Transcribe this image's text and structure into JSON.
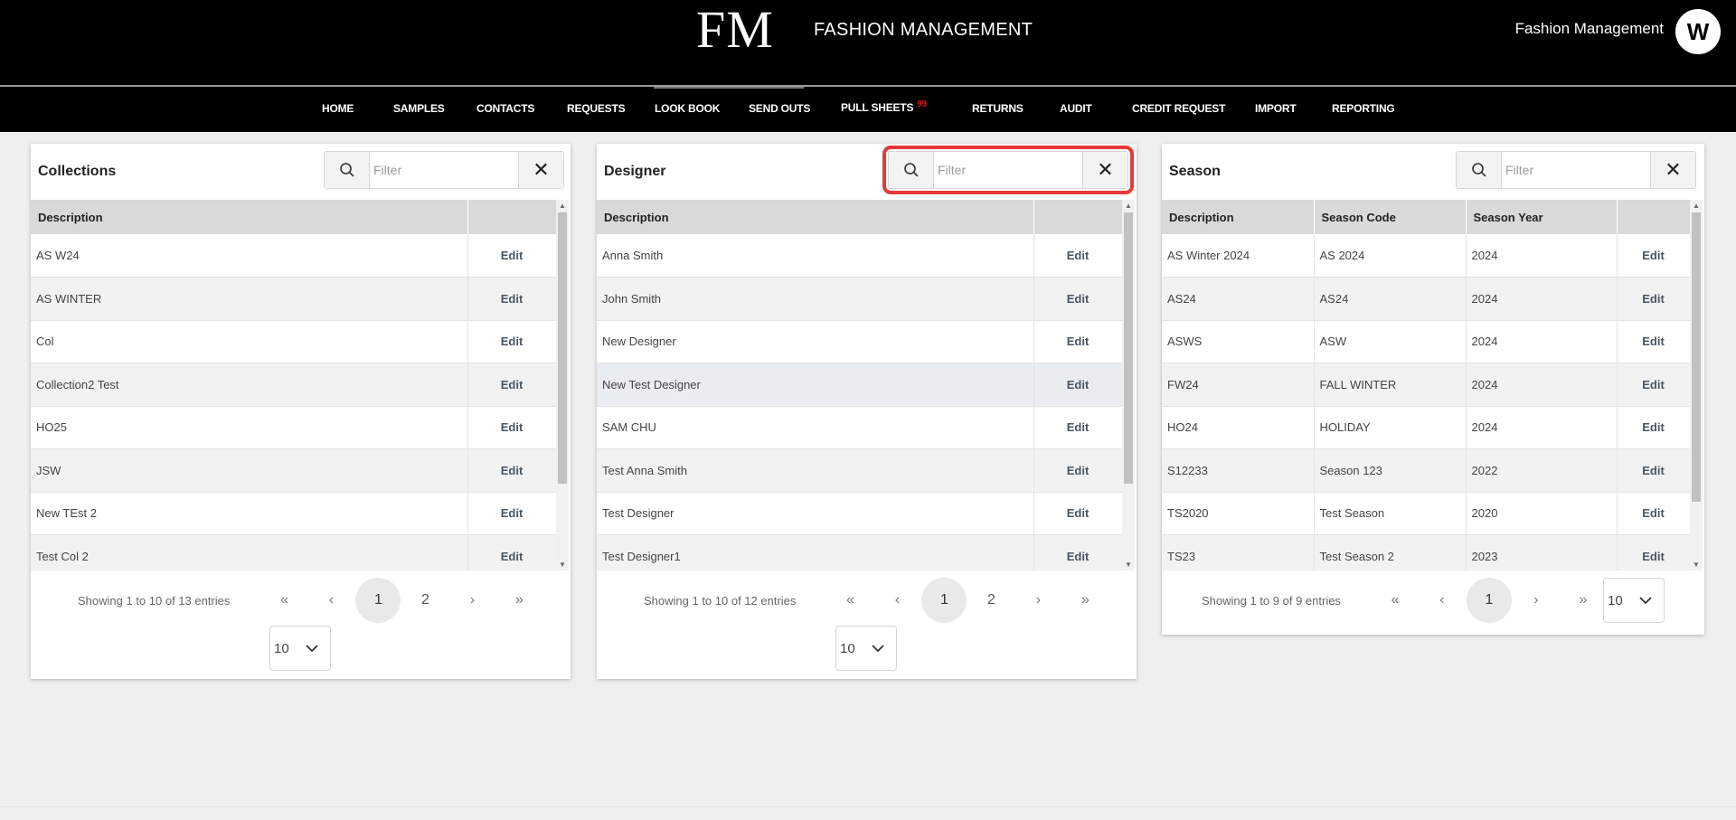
{
  "header": {
    "logo": "FM",
    "brand": "FASHION MANAGEMENT",
    "user_name": "Fashion Management",
    "avatar_letter": "W"
  },
  "nav": [
    {
      "label": "HOME"
    },
    {
      "label": "SAMPLES"
    },
    {
      "label": "CONTACTS"
    },
    {
      "label": "REQUESTS"
    },
    {
      "label": "LOOK BOOK"
    },
    {
      "label": "SEND OUTS"
    },
    {
      "label": "PULL SHEETS",
      "badge": "99"
    },
    {
      "label": "RETURNS"
    },
    {
      "label": "AUDIT"
    },
    {
      "label": "CREDIT REQUEST"
    },
    {
      "label": "IMPORT"
    },
    {
      "label": "REPORTING"
    }
  ],
  "collections": {
    "title": "Collections",
    "filter_placeholder": "Filter",
    "columns": [
      "Description",
      ""
    ],
    "rows": [
      [
        "AS W24",
        "Edit"
      ],
      [
        "AS WINTER",
        "Edit"
      ],
      [
        "Col",
        "Edit"
      ],
      [
        "Collection2 Test",
        "Edit"
      ],
      [
        "HO25",
        "Edit"
      ],
      [
        "JSW",
        "Edit"
      ],
      [
        "New TEst 2",
        "Edit"
      ],
      [
        "Test Col 2",
        "Edit"
      ]
    ],
    "showing": "Showing 1 to 10 of 13 entries",
    "pages": [
      "1",
      "2"
    ],
    "page_size": "10"
  },
  "designer": {
    "title": "Designer",
    "filter_placeholder": "Filter",
    "columns": [
      "Description",
      ""
    ],
    "rows": [
      [
        "Anna Smith",
        "Edit"
      ],
      [
        "John Smith",
        "Edit"
      ],
      [
        "New Designer",
        "Edit"
      ],
      [
        "New Test Designer",
        "Edit"
      ],
      [
        "SAM CHU",
        "Edit"
      ],
      [
        "Test Anna Smith",
        "Edit"
      ],
      [
        "Test Designer",
        "Edit"
      ],
      [
        "Test Designer1",
        "Edit"
      ]
    ],
    "showing": "Showing 1 to 10 of 12 entries",
    "pages": [
      "1",
      "2"
    ],
    "page_size": "10"
  },
  "season": {
    "title": "Season",
    "filter_placeholder": "Filter",
    "columns": [
      "Description",
      "Season Code",
      "Season Year",
      ""
    ],
    "rows": [
      [
        "AS Winter 2024",
        "AS 2024",
        "2024",
        "Edit"
      ],
      [
        "AS24",
        "AS24",
        "2024",
        "Edit"
      ],
      [
        "ASWS",
        "ASW",
        "2024",
        "Edit"
      ],
      [
        "FW24",
        "FALL WINTER",
        "2024",
        "Edit"
      ],
      [
        "HO24",
        "HOLIDAY",
        "2024",
        "Edit"
      ],
      [
        "S12233",
        "Season 123",
        "2022",
        "Edit"
      ],
      [
        "TS2020",
        "Test Season",
        "2020",
        "Edit"
      ],
      [
        "TS23",
        "Test Season 2",
        "2023",
        "Edit"
      ]
    ],
    "showing": "Showing 1 to 9 of 9 entries",
    "pages": [
      "1"
    ],
    "page_size": "10"
  },
  "pager_icons": {
    "first": "«",
    "prev": "‹",
    "next": "›",
    "last": "»"
  },
  "colors": {
    "highlight": "#e53939",
    "badge": "#e0141a"
  }
}
